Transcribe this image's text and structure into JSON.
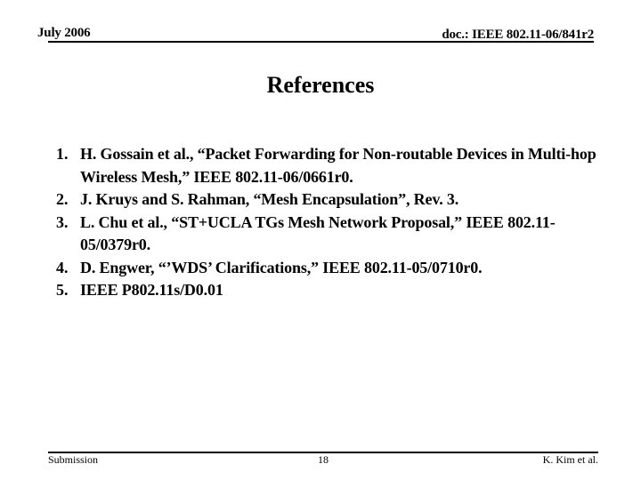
{
  "header": {
    "date": "July 2006",
    "doc_id": "doc.: IEEE 802.11-06/841r2"
  },
  "title": "References",
  "references": [
    {
      "number": "1.",
      "text": "H. Gossain et al., “Packet Forwarding for Non-routable Devices in Multi-hop Wireless Mesh,” IEEE 802.11-06/0661r0."
    },
    {
      "number": "2.",
      "text": "J. Kruys and S. Rahman, “Mesh Encapsulation”, Rev. 3."
    },
    {
      "number": "3.",
      "text": "L. Chu et al., “ST+UCLA TGs Mesh Network Proposal,” IEEE 802.11-05/0379r0."
    },
    {
      "number": "4.",
      "text": "D. Engwer, “’WDS’ Clarifications,” IEEE 802.11-05/0710r0."
    },
    {
      "number": "5.",
      "text": "IEEE P802.11s/D0.01"
    }
  ],
  "footer": {
    "left": "Submission",
    "page_number": "18",
    "author": "K. Kim et al."
  }
}
